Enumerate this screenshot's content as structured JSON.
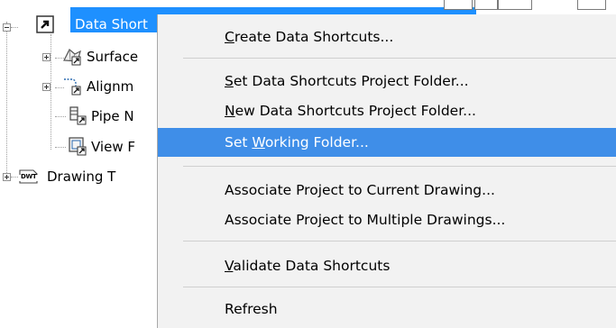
{
  "tree": {
    "items": [
      {
        "label": "Data Short",
        "icon": "data-shortcuts-icon",
        "expander": "minus",
        "selected": true
      },
      {
        "label": "Surface",
        "icon": "surface-icon",
        "expander": "plus"
      },
      {
        "label": "Alignm",
        "icon": "alignment-icon",
        "expander": "plus"
      },
      {
        "label": "Pipe N",
        "icon": "pipe-network-icon",
        "expander": "none"
      },
      {
        "label": "View F",
        "icon": "view-frame-icon",
        "expander": "none"
      },
      {
        "label": "Drawing T",
        "icon": "drawing-template-icon",
        "expander": "plus"
      }
    ],
    "dwt_icon_text": "DWT"
  },
  "menu": {
    "items": [
      {
        "pre": "",
        "ul": "C",
        "post": "reate Data Shortcuts..."
      },
      {
        "pre": "",
        "ul": "S",
        "post": "et Data Shortcuts Project Folder..."
      },
      {
        "pre": "",
        "ul": "N",
        "post": "ew Data Shortcuts Project Folder..."
      },
      {
        "pre": "Set ",
        "ul": "W",
        "post": "orking Folder...",
        "highlighted": true
      },
      {
        "pre": "Associate Project to Current Drawing...",
        "ul": "",
        "post": ""
      },
      {
        "pre": "Associate Project to Multiple Drawings...",
        "ul": "",
        "post": ""
      },
      {
        "pre": "",
        "ul": "V",
        "post": "alidate Data Shortcuts"
      },
      {
        "pre": "Refresh",
        "ul": "",
        "post": ""
      }
    ]
  },
  "colors": {
    "selection": "#1e90ff",
    "menu_highlight": "#3f8ee8",
    "menu_background": "#f2f2f2"
  }
}
